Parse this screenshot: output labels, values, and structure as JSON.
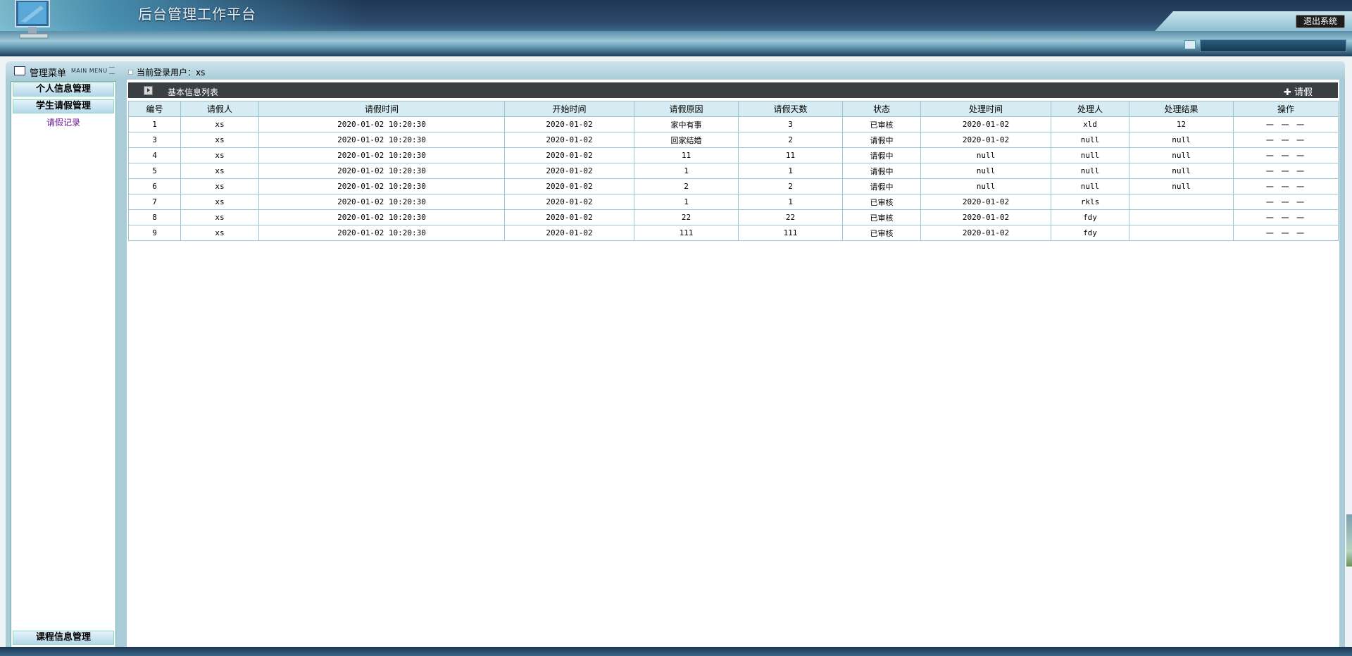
{
  "header": {
    "title": "后台管理工作平台",
    "logout_label": "退出系统"
  },
  "menubar": {
    "title": "管理菜单",
    "subtitle": "MAIN MENU",
    "user_label": "当前登录用户：xs"
  },
  "sidebar": {
    "sections": [
      {
        "label": "个人信息管理"
      },
      {
        "label": "学生请假管理"
      },
      {
        "label": "课程信息管理"
      }
    ],
    "links": [
      {
        "label": "请假记录"
      }
    ]
  },
  "panel": {
    "title": "基本信息列表",
    "add_label": "✚ 请假"
  },
  "table": {
    "columns": [
      "编号",
      "请假人",
      "请假时间",
      "开始时间",
      "请假原因",
      "请假天数",
      "状态",
      "处理时间",
      "处理人",
      "处理结果",
      "操作"
    ],
    "rows": [
      [
        "1",
        "xs",
        "2020-01-02 10:20:30",
        "2020-01-02",
        "家中有事",
        "3",
        "已审核",
        "2020-01-02",
        "xld",
        "12",
        "一 一 一"
      ],
      [
        "3",
        "xs",
        "2020-01-02 10:20:30",
        "2020-01-02",
        "回家结婚",
        "2",
        "请假中",
        "2020-01-02",
        "null",
        "null",
        "一 一 一"
      ],
      [
        "4",
        "xs",
        "2020-01-02 10:20:30",
        "2020-01-02",
        "11",
        "11",
        "请假中",
        "null",
        "null",
        "null",
        "一 一 一"
      ],
      [
        "5",
        "xs",
        "2020-01-02 10:20:30",
        "2020-01-02",
        "1",
        "1",
        "请假中",
        "null",
        "null",
        "null",
        "一 一 一"
      ],
      [
        "6",
        "xs",
        "2020-01-02 10:20:30",
        "2020-01-02",
        "2",
        "2",
        "请假中",
        "null",
        "null",
        "null",
        "一 一 一"
      ],
      [
        "7",
        "xs",
        "2020-01-02 10:20:30",
        "2020-01-02",
        "1",
        "1",
        "已审核",
        "2020-01-02",
        "rkls",
        "",
        "一 一 一"
      ],
      [
        "8",
        "xs",
        "2020-01-02 10:20:30",
        "2020-01-02",
        "22",
        "22",
        "已审核",
        "2020-01-02",
        "fdy",
        "",
        "一 一 一"
      ],
      [
        "9",
        "xs",
        "2020-01-02 10:20:30",
        "2020-01-02",
        "111",
        "111",
        "已审核",
        "2020-01-02",
        "fdy",
        "",
        "一 一 一"
      ]
    ]
  },
  "colors": {
    "header_dark": "#1f3552",
    "menu_bg": "#a9ccd8",
    "table_header": "#d6ebf2",
    "link": "#6a1b8f"
  }
}
